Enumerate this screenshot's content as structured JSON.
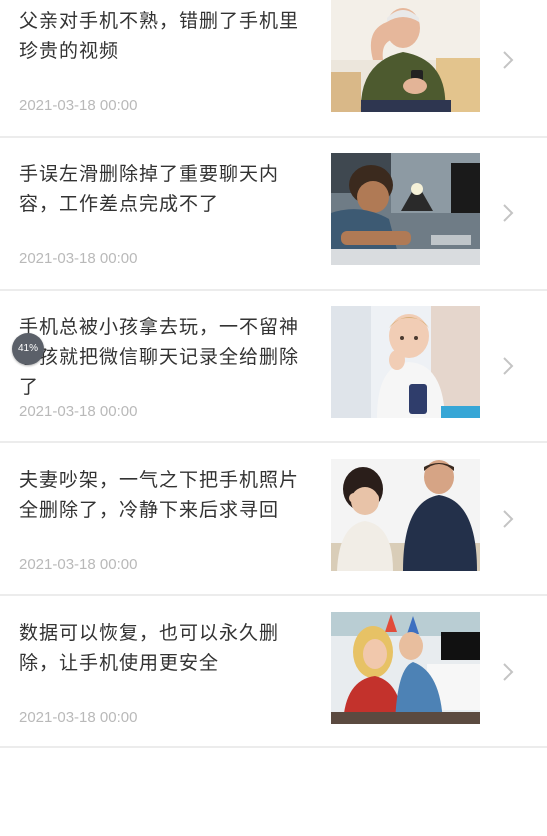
{
  "articles": [
    {
      "title": "父亲对手机不熟，错删了手机里珍贵的视频",
      "date": "2021-03-18 00:00",
      "thumbnail": "elderly-man-with-phone-photo"
    },
    {
      "title": "手误左滑删除掉了重要聊天内容，工作差点完成不了",
      "date": "2021-03-18 00:00",
      "thumbnail": "stressed-man-at-desk-photo"
    },
    {
      "title": "手机总被小孩拿去玩，一不留神小孩就把微信聊天记录全给删除了",
      "date": "2021-03-18 00:00",
      "thumbnail": "child-with-phone-photo"
    },
    {
      "title": "夫妻吵架，一气之下把手机照片全删除了，冷静下来后求寻回",
      "date": "2021-03-18 00:00",
      "thumbnail": "arguing-couple-photo"
    },
    {
      "title": "数据可以恢复，也可以永久删除，让手机使用更安全",
      "date": "2021-03-18 00:00",
      "thumbnail": "party-couple-photo"
    }
  ],
  "progress_badge": {
    "label": "41%",
    "value": 41
  },
  "colors": {
    "title": "#333333",
    "date": "#b9b9b9",
    "divider": "#ececec",
    "chevron": "#c4c4c4",
    "badge": "#5b6069"
  }
}
